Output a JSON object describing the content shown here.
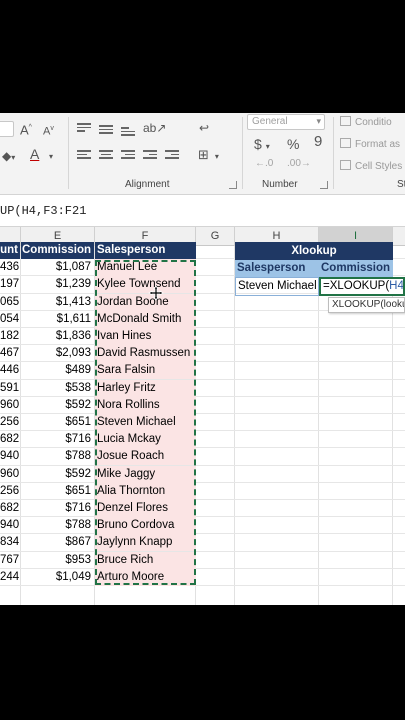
{
  "ribbon": {
    "number_format": "General",
    "group_alignment": "Alignment",
    "group_number": "Number",
    "styles": [
      "Conditio",
      "Format as",
      "Cell Styles"
    ],
    "font_grow": "A",
    "font_shrink": "A",
    "percent": "%",
    "currency": "$",
    "comma": "9",
    "font_color_letter": "A",
    "clipped_group": "St"
  },
  "formula_bar": {
    "text": "UP(H4,F3:F21"
  },
  "columns": [
    "D",
    "E",
    "F",
    "G",
    "H",
    "I"
  ],
  "table": {
    "headers": {
      "d": "unt",
      "e": "Commission",
      "f": "Salesperson"
    },
    "rows": [
      {
        "d": "436",
        "e": "$1,087",
        "f": "Manuel Lee"
      },
      {
        "d": "197",
        "e": "$1,239",
        "f": "Kylee Townsend"
      },
      {
        "d": "065",
        "e": "$1,413",
        "f": "Jordan Boone"
      },
      {
        "d": "054",
        "e": "$1,611",
        "f": "McDonald Smith"
      },
      {
        "d": "182",
        "e": "$1,836",
        "f": "Ivan Hines"
      },
      {
        "d": "467",
        "e": "$2,093",
        "f": "David Rasmussen"
      },
      {
        "d": "446",
        "e": "$489",
        "f": "Sara Falsin"
      },
      {
        "d": "591",
        "e": "$538",
        "f": "Harley Fritz"
      },
      {
        "d": "960",
        "e": "$592",
        "f": "Nora Rollins"
      },
      {
        "d": "256",
        "e": "$651",
        "f": "Steven Michael"
      },
      {
        "d": "682",
        "e": "$716",
        "f": "Lucia Mckay"
      },
      {
        "d": "940",
        "e": "$788",
        "f": "Josue Roach"
      },
      {
        "d": "960",
        "e": "$592",
        "f": "Mike Jaggy"
      },
      {
        "d": "256",
        "e": "$651",
        "f": "Alia Thornton"
      },
      {
        "d": "682",
        "e": "$716",
        "f": "Denzel Flores"
      },
      {
        "d": "940",
        "e": "$788",
        "f": "Bruno Cordova"
      },
      {
        "d": "834",
        "e": "$867",
        "f": "Jaylynn Knapp"
      },
      {
        "d": "767",
        "e": "$953",
        "f": "Bruce Rich"
      },
      {
        "d": "244",
        "e": "$1,049",
        "f": "Arturo Moore"
      }
    ]
  },
  "xlookup": {
    "title": "Xlookup",
    "col_salesperson": "Salesperson",
    "col_commission": "Commission",
    "lookup_value": "Steven Michael",
    "editing_prefix": "=XLOOKUP(",
    "editing_ref": "H4",
    "editing_suffix": ",F",
    "tooltip": "XLOOKUP(looku"
  },
  "colors": {
    "header_navy": "#1f3864",
    "subheader_blue": "#9dc3e6",
    "selection_green": "#217346",
    "range_pink": "#fbe4e4"
  }
}
